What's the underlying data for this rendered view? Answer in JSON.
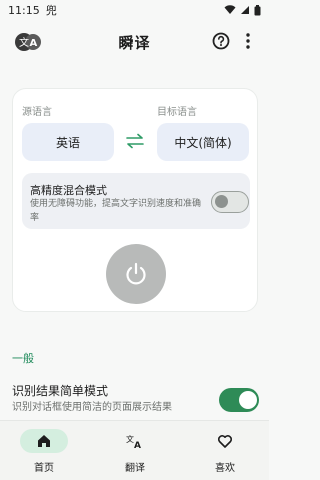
{
  "status_bar": {
    "time": "11:15",
    "notification_glyph": "兜"
  },
  "app_bar": {
    "title": "瞬译",
    "icons": [
      "translate-logo-icon",
      "help-icon",
      "more-vert-icon"
    ]
  },
  "translator_card": {
    "source_label": "源语言",
    "target_label": "目标语言",
    "source_language": "英语",
    "target_language": "中文(简体)",
    "swap_icon": "swap-arrows-icon",
    "hd_mode": {
      "title": "高精度混合模式",
      "description": "使用无障碍功能，提高文字识别速度和准确率",
      "enabled": false
    },
    "power_icon": "power-icon"
  },
  "settings": {
    "section_label": "一般",
    "simple_mode": {
      "title": "识别结果简单模式",
      "description": "识别对话框使用简洁的页面展示结果",
      "enabled": true
    }
  },
  "bottom_nav": {
    "items": [
      {
        "label": "首页",
        "icon": "home-icon",
        "active": true
      },
      {
        "label": "翻译",
        "icon": "translate-icon",
        "active": false
      },
      {
        "label": "喜欢",
        "icon": "heart-icon",
        "active": false
      }
    ]
  },
  "colors": {
    "accent": "#2e8b57",
    "section": "#1e8a5a",
    "lang_box": "#e9eef8"
  }
}
